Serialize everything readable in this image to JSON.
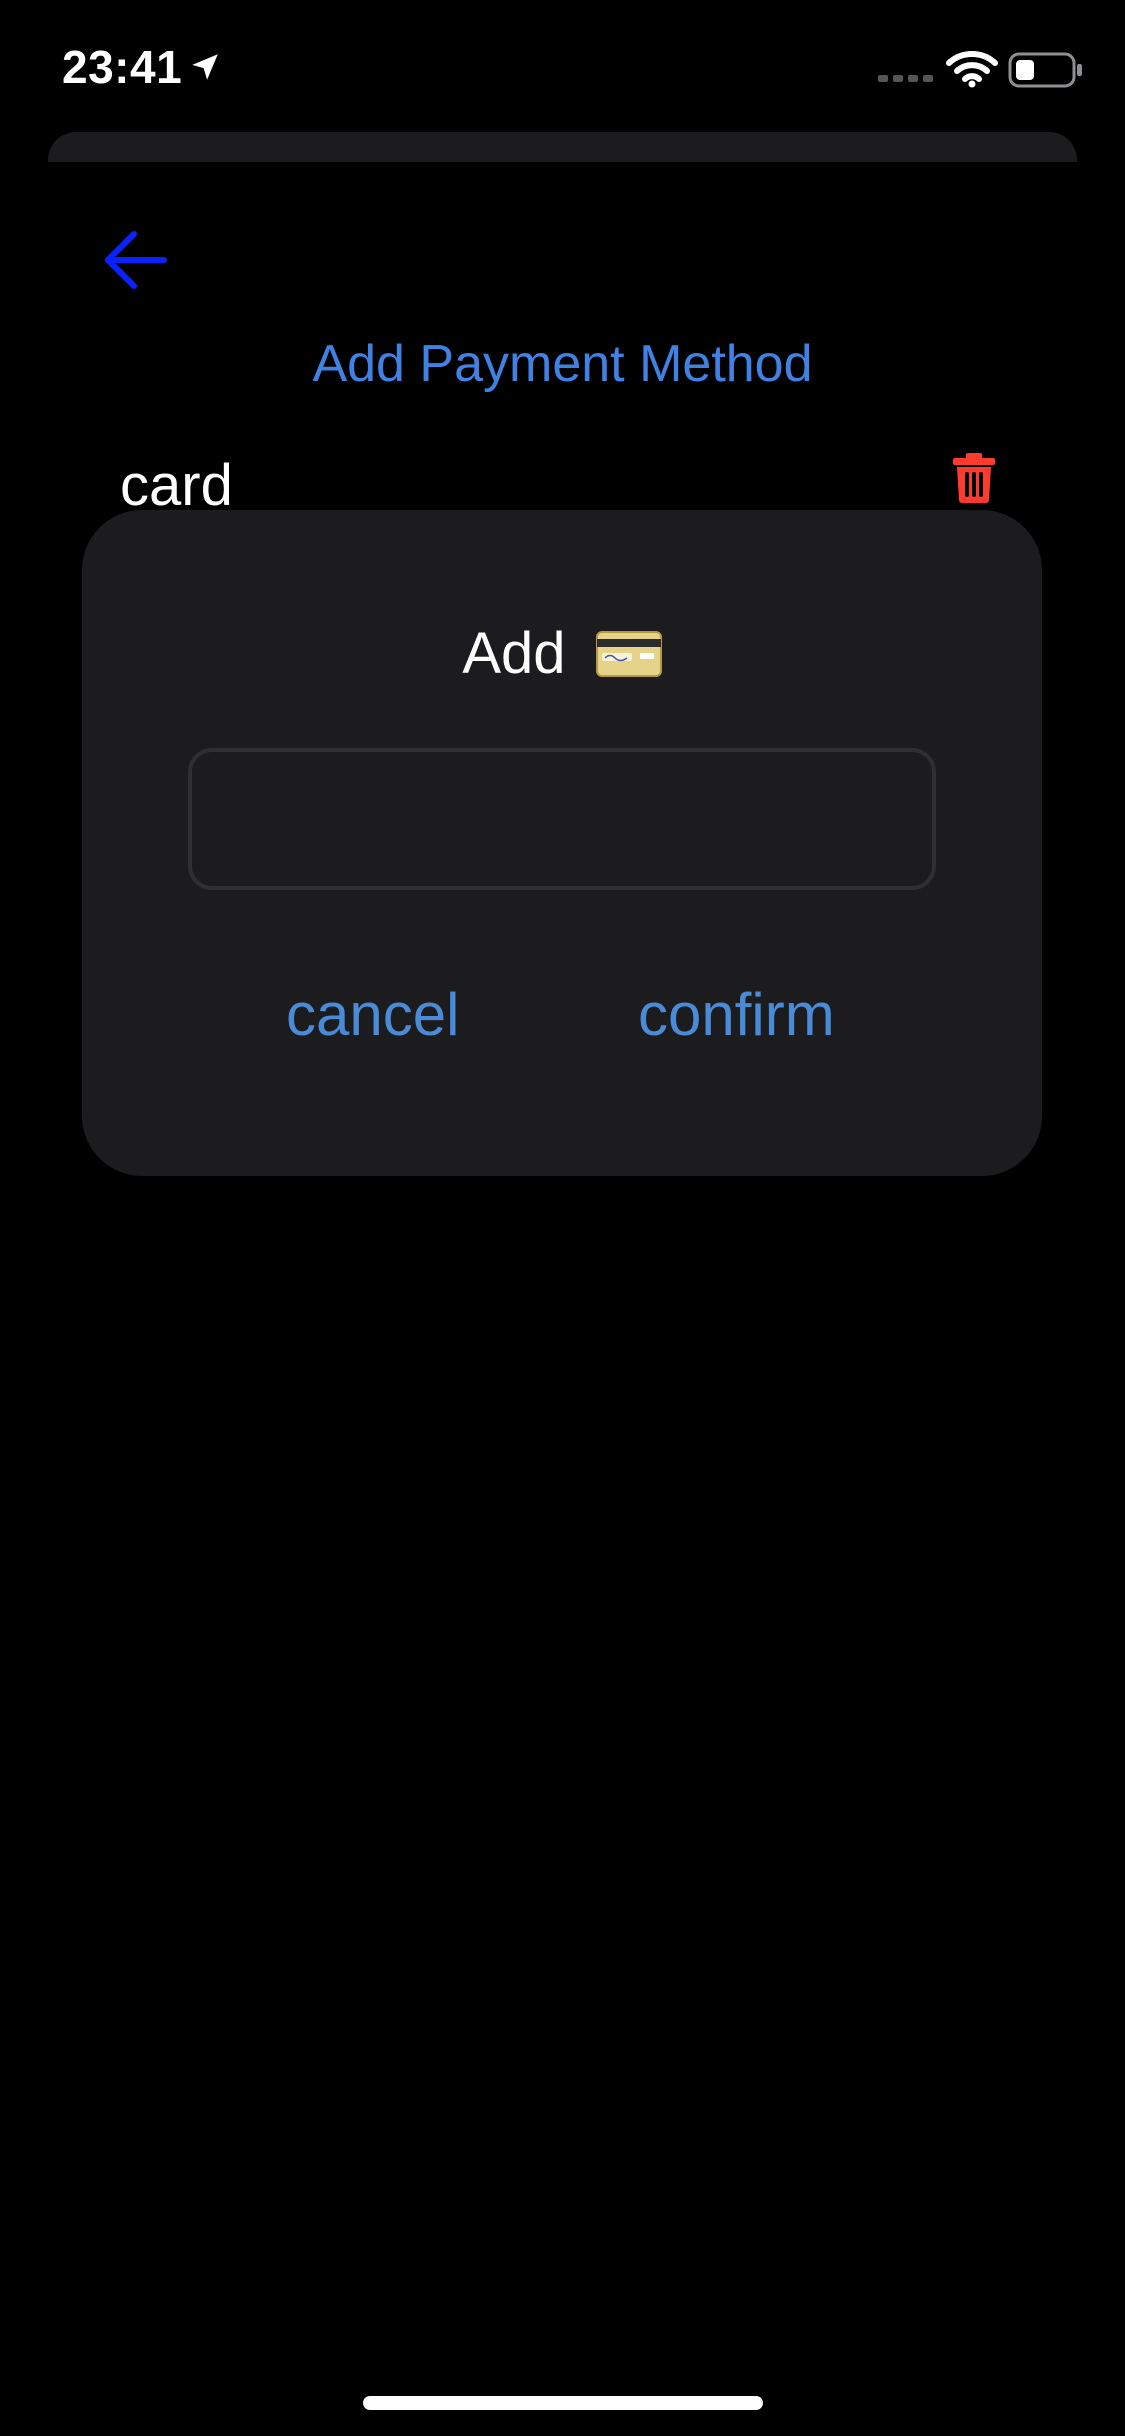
{
  "status_bar": {
    "time": "23:41",
    "icons": [
      "location-arrow-icon",
      "cellular-signal-icon",
      "wifi-icon",
      "battery-icon"
    ]
  },
  "header": {
    "back_icon": "arrow-left-icon",
    "title": "Add Payment Method"
  },
  "payment_methods": [
    {
      "label": "card",
      "delete_icon": "trash-icon"
    }
  ],
  "dialog": {
    "title": "Add",
    "title_icon": "credit-card-emoji-icon",
    "input_value": "",
    "input_placeholder": "",
    "cancel_label": "cancel",
    "confirm_label": "confirm"
  },
  "colors": {
    "background": "#000000",
    "surface": "#1c1c1e",
    "accent_blue": "#3f82e4",
    "back_arrow_blue": "#0a22ff",
    "delete_red": "#ff3b30",
    "text_white": "#ffffff"
  }
}
